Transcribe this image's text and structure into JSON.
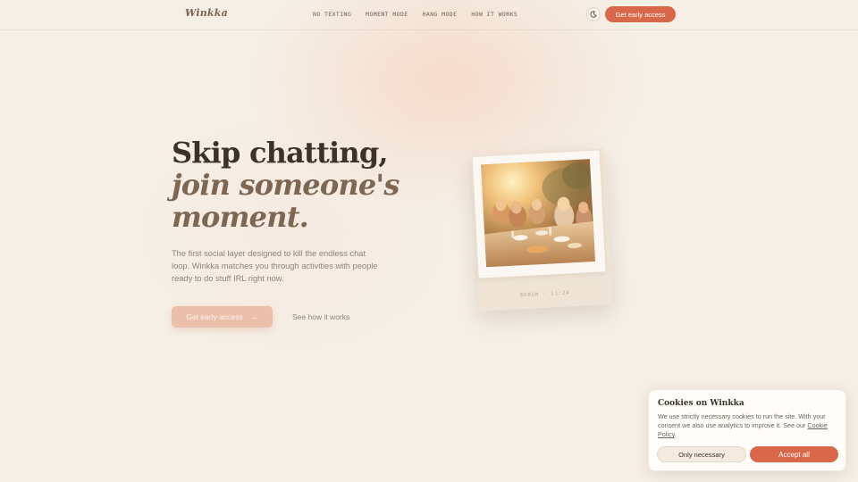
{
  "nav": {
    "logo": "Winkka",
    "links": [
      "NO TEXTING",
      "MOMENT MODE",
      "HANG MODE",
      "HOW IT WORKS"
    ],
    "theme_icon": "moon-icon",
    "cta_label": "Get early access"
  },
  "hero": {
    "title_line1": "Skip chatting,",
    "title_line2": "join someone's",
    "title_line3": "moment.",
    "description": "The first social layer designed to kill the endless chat loop. Winkka matches you through activities with people ready to do stuff IRL right now.",
    "cta_label": "Get early access",
    "cta_icon": "arrow-right-icon",
    "secondary_label": "See how it works"
  },
  "polaroid": {
    "caption": "BERGN · 11:24"
  },
  "cookie": {
    "title": "Cookies on Winkka",
    "text": "We use strictly necessary cookies to run the site. With your consent we also use analytics to improve it. See our",
    "link_label": "Cookie Policy",
    "link_suffix": ".",
    "necessary_label": "Only necessary",
    "accept_label": "Accept all"
  },
  "colors": {
    "background": "#f5efe6",
    "accent": "#d9674a",
    "title_dark": "#3d3229",
    "title_italic": "#7d6753"
  }
}
